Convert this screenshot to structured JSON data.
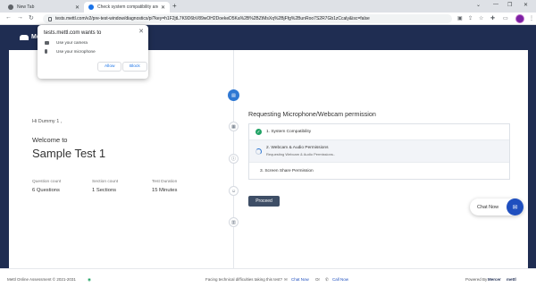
{
  "browser": {
    "tabs": [
      {
        "title": "New Tab",
        "favicon_color": "#5f6368"
      },
      {
        "title": "Check system compatibility and",
        "favicon_color": "#1a73e8"
      }
    ],
    "url": "tests.mettl.com/v2/pre-test-window/diagnostics/pi?key=h1F2jtL7K9D6bV89wOH2DoekeD5Ka%2B%2BZtMsXq%2BjFfg%2BunRoo7S2R7Gb1zCcaly&isc=false"
  },
  "permission_popup": {
    "title": "tests.mettl.com wants to",
    "items": [
      {
        "label": "Use your camera",
        "icon": "camera-icon"
      },
      {
        "label": "Use your microphone",
        "icon": "microphone-icon"
      }
    ],
    "allow_label": "Allow",
    "block_label": "Block"
  },
  "header": {
    "logo_text": "Mer"
  },
  "left": {
    "greeting": "Hi Dummy 1 ,",
    "welcome": "Welcome to",
    "test_name": "Sample Test 1",
    "stats": [
      {
        "label": "Question count",
        "value": "6 Questions"
      },
      {
        "label": "Section count",
        "value": "1 Sections"
      },
      {
        "label": "Test Duration",
        "value": "15  Minutes"
      }
    ]
  },
  "right": {
    "title": "Requesting Microphone/Webcam permission",
    "checks": [
      {
        "label": "1. System Compatibility",
        "status": "done"
      },
      {
        "label": "2. Webcam & Audio Permissions",
        "sub": "Requesting Webcam & Audio Permissions..",
        "status": "in-progress"
      },
      {
        "label": "3. Screen Share Permission",
        "status": "pending"
      }
    ],
    "proceed_label": "Proceed"
  },
  "chat": {
    "label": "Chat Now"
  },
  "footer": {
    "copyright": "Mettl Online Assessment © 2021-2031",
    "help_text": "Facing technical difficulties taking this test?",
    "chat_link": "Chat Now",
    "or": "Or",
    "call_link": "Call Now",
    "powered_by": "Powered By",
    "brand1": "Mercer",
    "brand2": "mettl"
  },
  "colors": {
    "accent": "#2f78d3",
    "header": "#1f2d52",
    "success": "#21a365"
  }
}
